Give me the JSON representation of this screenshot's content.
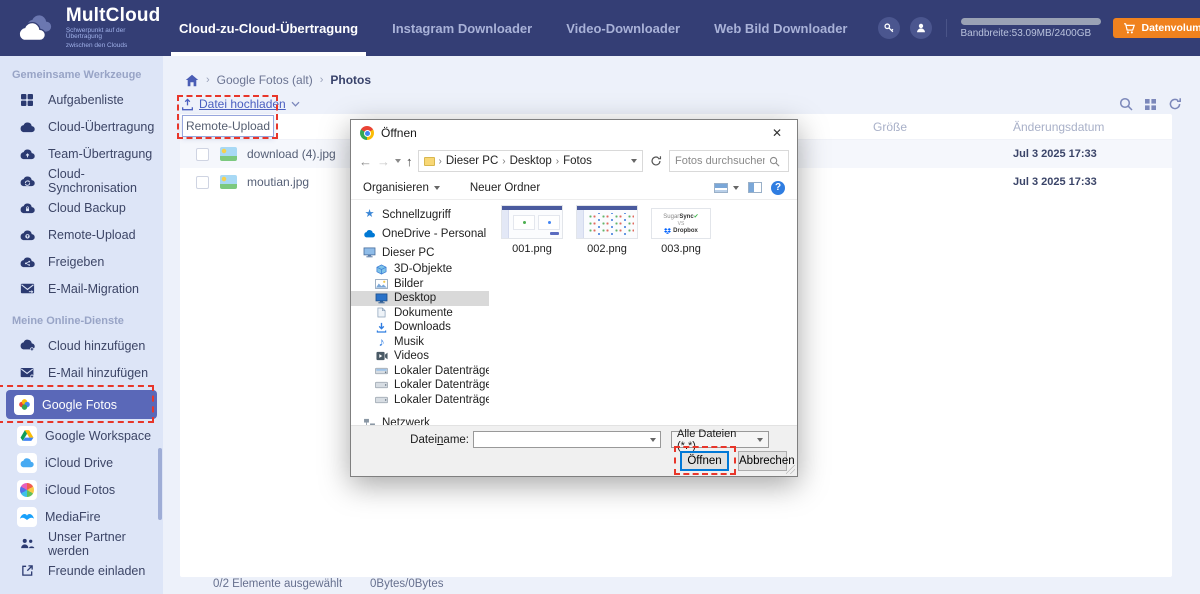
{
  "colors": {
    "header_bg": "#343e75",
    "accent_orange": "#f0821e",
    "sidebar_bg": "#dde5f7",
    "selected_service_bg": "#5a68b8",
    "annotation_red": "#e8362a",
    "link_blue": "#4a5fc0",
    "dialog_default_button_border": "#0078d7"
  },
  "header": {
    "logo_name": "MultCloud",
    "logo_tagline_line1": "Schwerpunkt auf der Übertragung",
    "logo_tagline_line2": "zwischen den Clouds",
    "nav": [
      {
        "label": "Cloud-zu-Cloud-Übertragung",
        "active": true
      },
      {
        "label": "Instagram Downloader",
        "active": false
      },
      {
        "label": "Video-Downloader",
        "active": false
      },
      {
        "label": "Web Bild Downloader",
        "active": false
      }
    ],
    "bandwidth_text": "Bandbreite:53.09MB/2400GB",
    "buy_button_label": "Datenvolumen kaufen"
  },
  "sidebar": {
    "section_common_tools": "Gemeinsame Werkzeuge",
    "tools": [
      {
        "label": "Aufgabenliste",
        "icon": "task-grid-icon"
      },
      {
        "label": "Cloud-Übertragung",
        "icon": "cloud-transfer-icon"
      },
      {
        "label": "Team-Übertragung",
        "icon": "team-transfer-icon"
      },
      {
        "label": "Cloud-Synchronisation",
        "icon": "cloud-sync-icon"
      },
      {
        "label": "Cloud Backup",
        "icon": "cloud-backup-icon"
      },
      {
        "label": "Remote-Upload",
        "icon": "remote-upload-icon"
      },
      {
        "label": "Freigeben",
        "icon": "cloud-share-icon"
      },
      {
        "label": "E-Mail-Migration",
        "icon": "email-migration-icon"
      }
    ],
    "section_my_services": "Meine Online-Dienste",
    "services": [
      {
        "label": "Cloud hinzufügen",
        "icon": "add-cloud-icon"
      },
      {
        "label": "E-Mail hinzufügen",
        "icon": "add-email-icon"
      },
      {
        "label": "Google Fotos",
        "icon": "google-photos-icon",
        "selected": true
      },
      {
        "label": "Google Workspace",
        "icon": "google-drive-icon"
      },
      {
        "label": "iCloud Drive",
        "icon": "icloud-drive-icon"
      },
      {
        "label": "iCloud Fotos",
        "icon": "icloud-photos-icon"
      },
      {
        "label": "MediaFire",
        "icon": "mediafire-icon"
      },
      {
        "label": "Unser Partner werden",
        "icon": "partner-icon"
      },
      {
        "label": "Freunde einladen",
        "icon": "invite-icon"
      }
    ]
  },
  "main": {
    "breadcrumb": {
      "items": [
        "Google Fotos (alt)",
        "Photos"
      ]
    },
    "upload_link_label": "Datei hochladen",
    "upload_menu_item": "Remote-Upload",
    "table": {
      "col_size": "Größe",
      "col_modified": "Änderungsdatum",
      "rows": [
        {
          "name": "download (4).jpg",
          "modified": "Jul 3 2025 17:33"
        },
        {
          "name": "moutian.jpg",
          "modified": "Jul 3 2025 17:33"
        }
      ]
    },
    "status": {
      "selection": "0/2 Elemente ausgewählt",
      "bytes": "0Bytes/0Bytes"
    }
  },
  "dialog": {
    "title": "Öffnen",
    "address": {
      "crumbs": [
        "Dieser PC",
        "Desktop",
        "Fotos"
      ]
    },
    "search_placeholder": "Fotos durchsuchen",
    "toolbar": {
      "organize_label": "Organisieren",
      "new_folder_label": "Neuer Ordner"
    },
    "tree": [
      {
        "label": "Schnellzugriff"
      },
      {
        "label": "OneDrive - Personal"
      },
      {
        "label": "Dieser PC"
      },
      {
        "label": "3D-Objekte"
      },
      {
        "label": "Bilder"
      },
      {
        "label": "Desktop",
        "selected": true
      },
      {
        "label": "Dokumente"
      },
      {
        "label": "Downloads"
      },
      {
        "label": "Musik"
      },
      {
        "label": "Videos"
      },
      {
        "label": "Lokaler Datenträger (C:)"
      },
      {
        "label": "Lokaler Datenträger (D:)"
      },
      {
        "label": "Lokaler Datenträger (E:)"
      },
      {
        "label": "Netzwerk"
      }
    ],
    "files": [
      {
        "label": "001.png"
      },
      {
        "label": "002.png"
      },
      {
        "label": "003.png",
        "thumb_text": {
          "brand1_a": "Sugar",
          "brand1_b": "Sync",
          "vs": "VS",
          "brand2": "Dropbox"
        }
      }
    ],
    "filename": {
      "label_pre": "Datei",
      "label_mnemonic": "n",
      "label_post": "ame:",
      "value": ""
    },
    "filetype_value": "Alle Dateien (*.*)",
    "open_button_label": "Öffnen",
    "cancel_button_label": "Abbrechen"
  }
}
